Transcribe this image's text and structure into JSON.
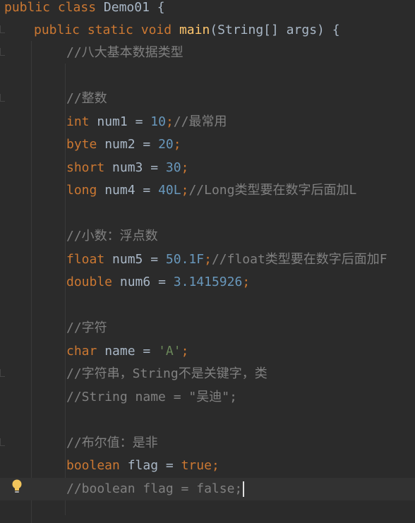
{
  "editor": {
    "lines": [
      {
        "kw1": "public",
        "kw2": "class",
        "name": "Demo01",
        "brace": "{"
      },
      {
        "kw1": "public",
        "kw2": "static",
        "kw3": "void",
        "fn": "main",
        "params": "(String[] args)",
        "brace": "{"
      },
      {
        "comment": "//八大基本数据类型"
      },
      {
        "comment": "//整数"
      },
      {
        "type": "int",
        "var": "num1",
        "eq": "=",
        "value": "10",
        "semi": ";",
        "comment": "//最常用"
      },
      {
        "type": "byte",
        "var": "num2",
        "eq": "=",
        "value": "20",
        "semi": ";"
      },
      {
        "type": "short",
        "var": "num3",
        "eq": "=",
        "value": "30",
        "semi": ";"
      },
      {
        "type": "long",
        "var": "num4",
        "eq": "=",
        "value": "40L",
        "semi": ";",
        "comment": "//Long类型要在数字后面加L"
      },
      {
        "comment": "//小数：浮点数"
      },
      {
        "type": "float",
        "var": "num5",
        "eq": "=",
        "value": "50.1F",
        "semi": ";",
        "comment": "//float类型要在数字后面加F"
      },
      {
        "type": "double",
        "var": "num6",
        "eq": "=",
        "value": "3.1415926",
        "semi": ";"
      },
      {
        "comment": "//字符"
      },
      {
        "type": "char",
        "var": "name",
        "eq": "=",
        "value": "'A'",
        "semi": ";"
      },
      {
        "comment": "//字符串，String不是关键字，类"
      },
      {
        "comment": "//String name = \"吴迪\";"
      },
      {
        "comment": "//布尔值：是非"
      },
      {
        "type": "boolean",
        "var": "flag",
        "eq": "=",
        "value": "true",
        "semi": ";"
      },
      {
        "comment": "//boolean flag = false;"
      }
    ]
  },
  "colors": {
    "background": "#2b2b2b",
    "keyword": "#cc7832",
    "number": "#6897bb",
    "string": "#6a8759",
    "function": "#ffc66d",
    "comment": "#808080",
    "text": "#a9b7c6",
    "current_line": "#323232"
  },
  "gutter": {
    "intention_icon": "lightbulb-icon"
  }
}
